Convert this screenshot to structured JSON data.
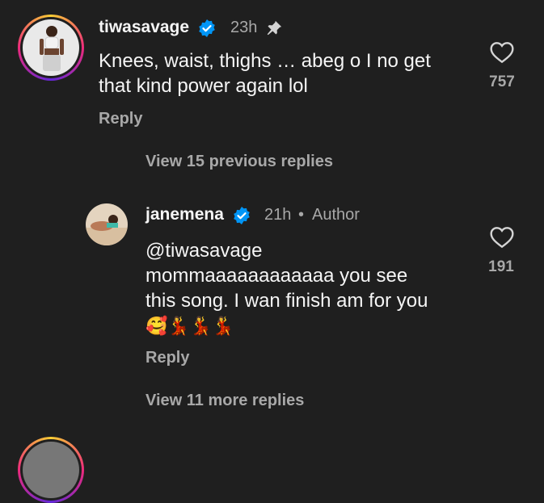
{
  "comments": [
    {
      "username": "tiwasavage",
      "time": "23h",
      "pinned": true,
      "text_line1": "Knees, waist, thighs … abeg o I no get",
      "text_line2": "that kind power again lol",
      "reply_label": "Reply",
      "like_count": "757",
      "icons": [
        "verified-badge-icon",
        "pin-icon",
        "heart-icon"
      ]
    }
  ],
  "view_previous": "View 15 previous replies",
  "reply": {
    "username": "janemena",
    "time": "21h",
    "separator": "•",
    "author_tag": "Author",
    "mention": "@tiwasavage",
    "text_line2": "mommaaaaaaaaaaaa you see",
    "text_line3": "this song. I wan finish am for you",
    "emojis": "🥰💃💃💃",
    "reply_label": "Reply",
    "like_count": "191",
    "icons": [
      "verified-badge-icon",
      "heart-icon"
    ]
  },
  "view_more": "View 11 more replies",
  "colors": {
    "background": "#1f1f1f",
    "text": "#f5f5f5",
    "secondary": "#a8a8a8",
    "verified": "#0095f6"
  }
}
